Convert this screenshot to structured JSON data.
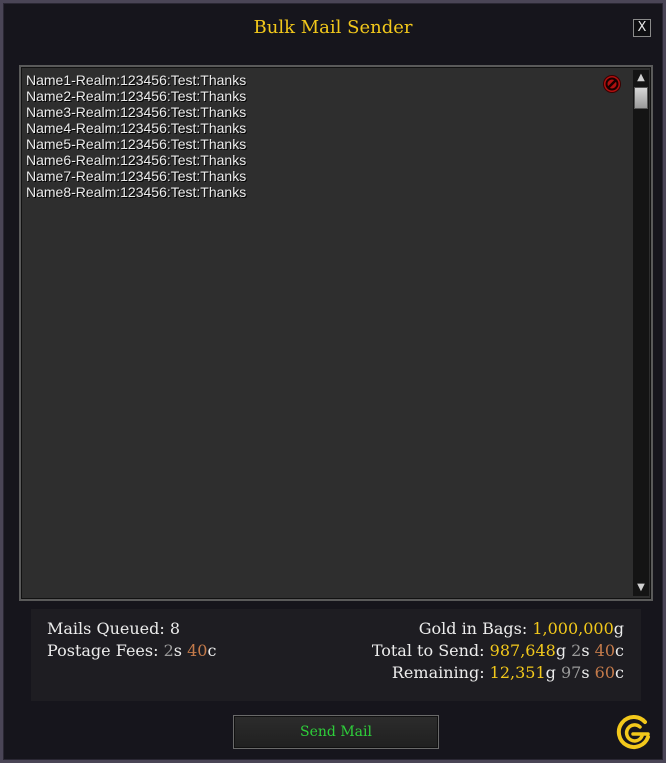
{
  "window": {
    "title": "Bulk Mail Sender",
    "close_label": "X"
  },
  "editbox": {
    "lines": [
      "Name1-Realm:123456:Test:Thanks",
      "Name2-Realm:123456:Test:Thanks",
      "Name3-Realm:123456:Test:Thanks",
      "Name4-Realm:123456:Test:Thanks",
      "Name5-Realm:123456:Test:Thanks",
      "Name6-Realm:123456:Test:Thanks",
      "Name7-Realm:123456:Test:Thanks",
      "Name8-Realm:123456:Test:Thanks"
    ],
    "clear_icon": "no-entry-icon"
  },
  "stats": {
    "mails_queued": {
      "label": "Mails Queued:",
      "value": "8"
    },
    "postage_fees": {
      "label": "Postage Fees:",
      "silver": "2",
      "silver_unit": "s",
      "copper": "40",
      "copper_unit": "c"
    },
    "gold_in_bags": {
      "label": "Gold in Bags:",
      "gold": "1,000,000",
      "gold_unit": "g"
    },
    "total_to_send": {
      "label": "Total to Send:",
      "gold": "987,648",
      "gold_unit": "g",
      "silver": "2",
      "silver_unit": "s",
      "copper": "40",
      "copper_unit": "c"
    },
    "remaining": {
      "label": "Remaining:",
      "gold": "12,351",
      "gold_unit": "g",
      "silver": "97",
      "silver_unit": "s",
      "copper": "60",
      "copper_unit": "c"
    }
  },
  "actions": {
    "send_mail_label": "Send Mail"
  },
  "colors": {
    "title": "#f2c81b",
    "gold": "#f2c81b",
    "silver": "#9a9a9a",
    "copper": "#c47a4a",
    "send_text": "#2ecf3a"
  },
  "logo": {
    "icon": "addon-logo-icon"
  }
}
